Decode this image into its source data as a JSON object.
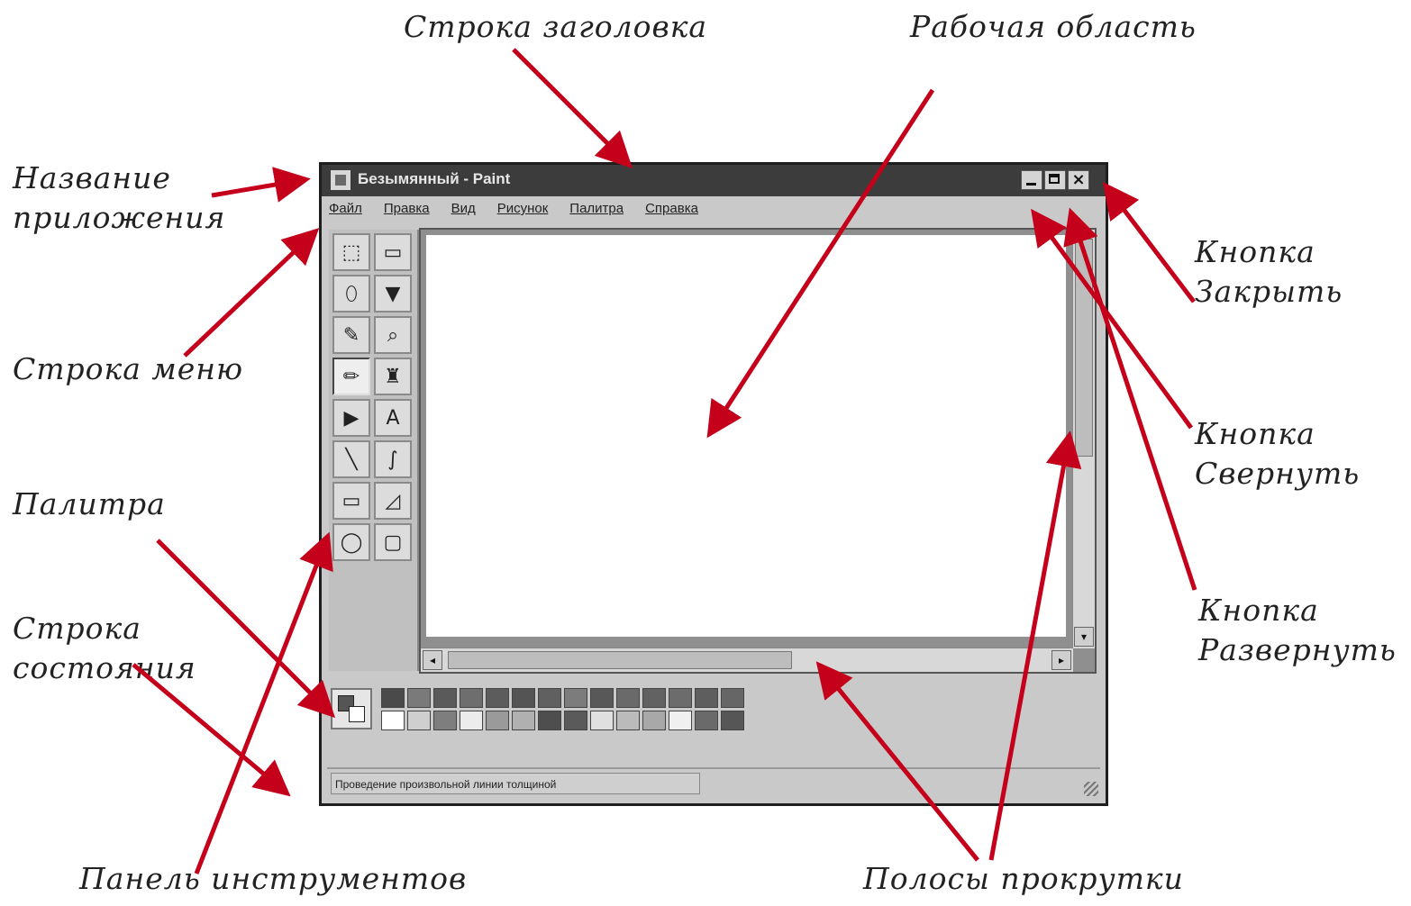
{
  "annotations": {
    "title_bar": "Строка заголовка",
    "work_area": "Рабочая область",
    "app_name_line1": "Название",
    "app_name_line2": "приложения",
    "menu_bar": "Строка меню",
    "palette": "Палитра",
    "status_bar_line1": "Строка",
    "status_bar_line2": "состояния",
    "toolbox": "Панель инструментов",
    "scrollbars": "Полосы прокрутки",
    "close_line1": "Кнопка",
    "close_line2": "Закрыть",
    "minimize_line1": "Кнопка",
    "minimize_line2": "Свернуть",
    "maximize_line1": "Кнопка",
    "maximize_line2": "Развернуть"
  },
  "window": {
    "title": "Безымянный - Paint",
    "close_glyph": "×"
  },
  "menu": {
    "items": [
      "Файл",
      "Правка",
      "Вид",
      "Рисунок",
      "Палитра",
      "Справка"
    ]
  },
  "tools": [
    {
      "icon": "free-select-icon",
      "glyph": "⬚"
    },
    {
      "icon": "rect-select-icon",
      "glyph": "▭"
    },
    {
      "icon": "eraser-icon",
      "glyph": "⬯"
    },
    {
      "icon": "fill-icon",
      "glyph": "▼"
    },
    {
      "icon": "color-picker-icon",
      "glyph": "✎"
    },
    {
      "icon": "magnifier-icon",
      "glyph": "⌕"
    },
    {
      "icon": "pencil-icon",
      "glyph": "✏"
    },
    {
      "icon": "brush-icon",
      "glyph": "♜"
    },
    {
      "icon": "airbrush-icon",
      "glyph": "▶"
    },
    {
      "icon": "text-icon",
      "glyph": "A"
    },
    {
      "icon": "line-icon",
      "glyph": "╲"
    },
    {
      "icon": "curve-icon",
      "glyph": "∫"
    },
    {
      "icon": "rectangle-icon",
      "glyph": "▭"
    },
    {
      "icon": "polygon-icon",
      "glyph": "◿"
    },
    {
      "icon": "ellipse-icon",
      "glyph": "◯"
    },
    {
      "icon": "rounded-rect-icon",
      "glyph": "▢"
    }
  ],
  "palette_colors": [
    "#4a4a4a",
    "#7a7a7a",
    "#5a5a5a",
    "#6e6e6e",
    "#5c5c5c",
    "#545454",
    "#606060",
    "#7c7c7c",
    "#585858",
    "#6a6a6a",
    "#626262",
    "#6c6c6c",
    "#5e5e5e",
    "#666666",
    "#ffffff",
    "#cfcfcf",
    "#7e7e7e",
    "#ececec",
    "#9a9a9a",
    "#b0b0b0",
    "#4e4e4e",
    "#5a5a5a",
    "#e0e0e0",
    "#bbbbbb",
    "#a8a8a8",
    "#f0f0f0",
    "#6a6a6a",
    "#565656"
  ],
  "status": {
    "text": "Проведение произвольной линии толщиной"
  },
  "colors": {
    "arrow": "#c4001a",
    "title_bar": "#3c3c3c"
  }
}
